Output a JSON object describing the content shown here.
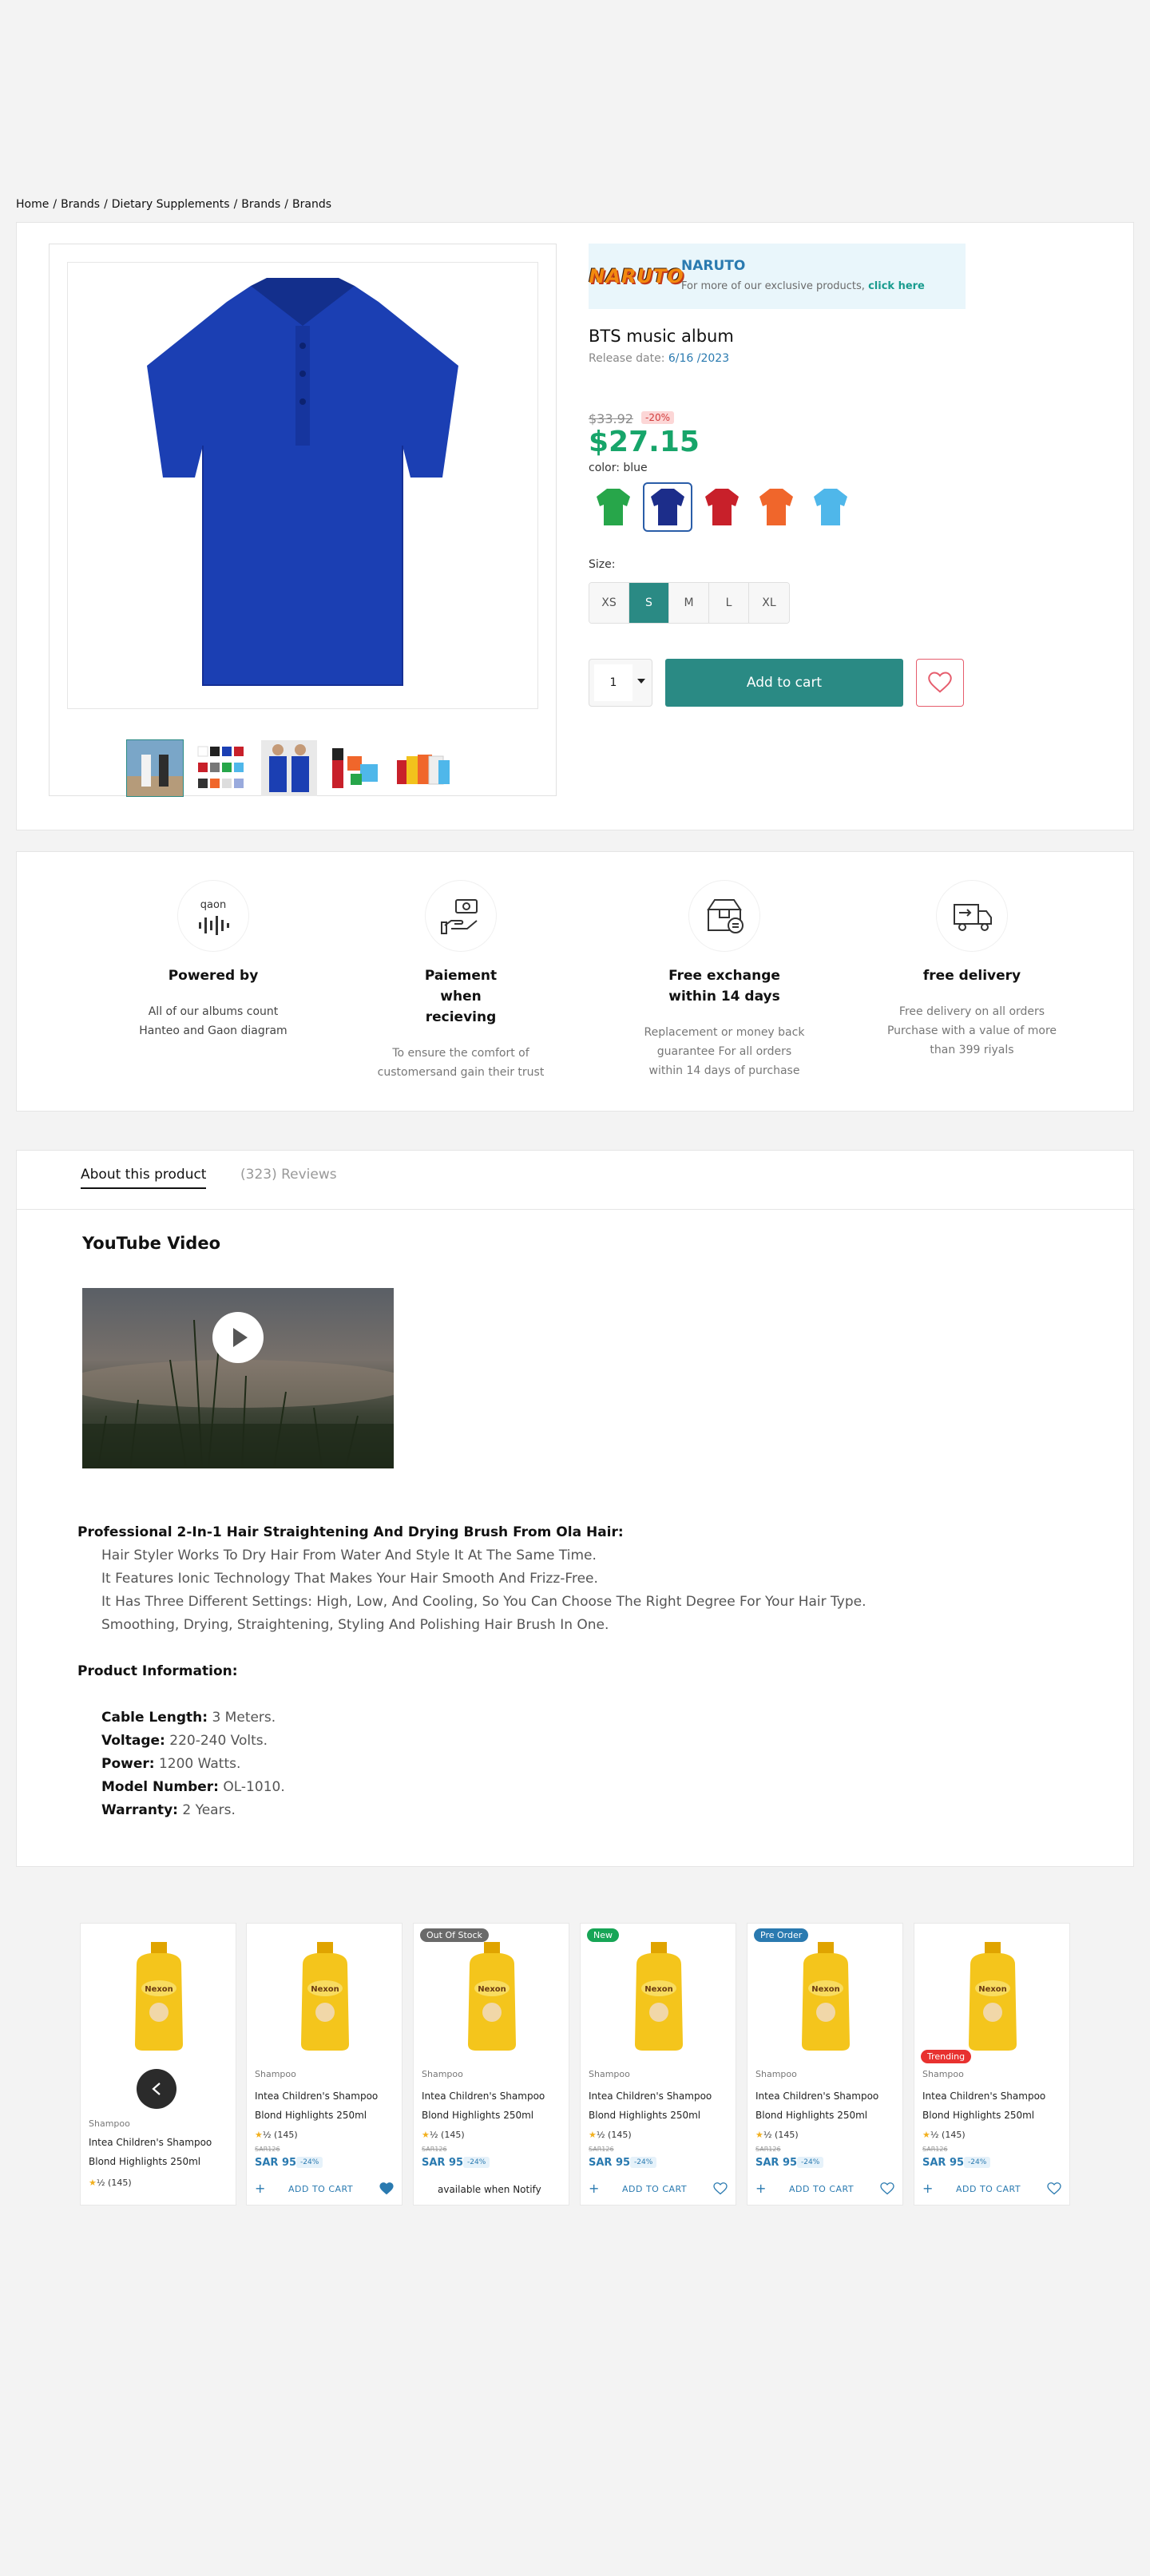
{
  "breadcrumb": [
    "Home",
    "Brands",
    "Dietary Supplements",
    "Brands",
    "Brands"
  ],
  "brand": {
    "logo_text": "NARUTO",
    "name": "NARUTO",
    "note": "For more of our exclusive products, ",
    "link": "click here"
  },
  "product": {
    "title": "BTS music album",
    "release_label": "Release date: ",
    "release_date": "6/16 /2023",
    "old_price": "$33.92",
    "discount": "-20%",
    "price": "$27.15",
    "color_label": "color: blue",
    "colors": [
      "#27a64a",
      "#1c2d8a",
      "#c8202a",
      "#f0662b",
      "#4fb7ea"
    ],
    "size_label": "Size:",
    "sizes": [
      "XS",
      "S",
      "M",
      "L",
      "XL"
    ],
    "quantity": "1",
    "add_to_cart": "Add to cart",
    "main_color": "#1b3fb3"
  },
  "features": [
    {
      "title": "Powered by",
      "desc": "All of our albums count Hanteo and Gaon diagram",
      "icon": "chart-icon"
    },
    {
      "title": "Paiement when recieving",
      "desc": "To ensure the comfort of customersand gain their trust",
      "icon": "hand-money-icon"
    },
    {
      "title": "Free exchange within 14 days",
      "desc": "Replacement or money back guarantee For all orders within 14 days of purchase",
      "icon": "box-exchange-icon"
    },
    {
      "title": "free delivery",
      "desc": "Free delivery on all orders Purchase with a value of more than 399 riyals",
      "icon": "truck-icon"
    }
  ],
  "feature_icon_text": "qaon",
  "tabs": {
    "about": "About this product",
    "reviews": "(323) Reviews"
  },
  "about": {
    "yt_heading": "YouTube Video",
    "heading1": "Professional 2-In-1 Hair Straightening And Drying Brush From Ola Hair:",
    "lines": [
      "Hair Styler Works To Dry Hair From Water And Style It At The Same Time.",
      "It Features Ionic Technology That Makes Your Hair Smooth And Frizz-Free.",
      "It Has Three Different Settings: High, Low, And Cooling, So You Can Choose The Right Degree For Your Hair Type.",
      "Smoothing, Drying, Straightening, Styling And Polishing Hair Brush In One."
    ],
    "heading2": "Product Information:",
    "info": [
      {
        "k": "Cable Length:",
        "v": " 3 Meters."
      },
      {
        "k": "Voltage:",
        "v": " 220-240 Volts."
      },
      {
        "k": "Power:",
        "v": " 1200 Watts."
      },
      {
        "k": "Model Number:",
        "v": " OL-1010."
      },
      {
        "k": "Warranty:",
        "v": " 2 Years."
      }
    ]
  },
  "carousel": {
    "category": "Shampoo",
    "name": "Intea Children's Shampoo Blond Highlights 250ml",
    "rating": "(145)",
    "old_price": "SAR126",
    "price": "SAR 95",
    "off": "-24%",
    "add": "ADD TO CART",
    "notify": "available when Notify",
    "bottle_label": "Nexon",
    "badges": {
      "out": "Out Of Stock",
      "new": "New",
      "pre": "Pre Order",
      "trend": "Trending"
    }
  }
}
